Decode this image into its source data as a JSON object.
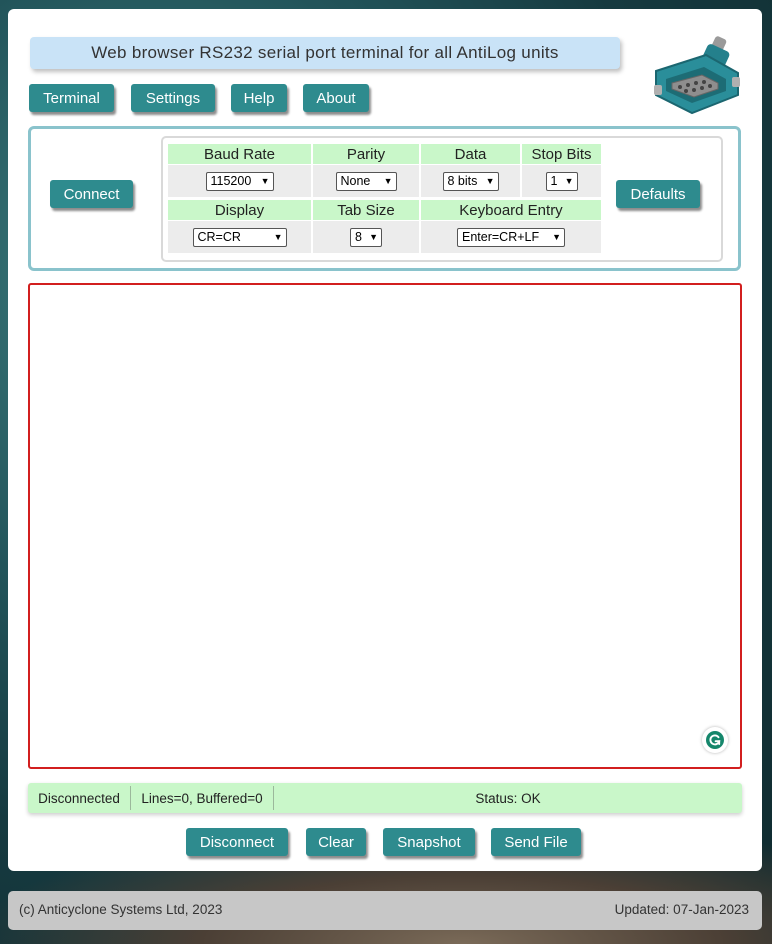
{
  "header": {
    "title": "Web browser RS232 serial port terminal for all AntiLog units",
    "logo_icon": "serial-connector-icon"
  },
  "nav": {
    "terminal": "Terminal",
    "settings": "Settings",
    "help": "Help",
    "about": "About"
  },
  "settings": {
    "connect_label": "Connect",
    "defaults_label": "Defaults",
    "baud_rate": {
      "label": "Baud Rate",
      "value": "115200"
    },
    "parity": {
      "label": "Parity",
      "value": "None"
    },
    "data_bits": {
      "label": "Data",
      "value": "8 bits"
    },
    "stop_bits": {
      "label": "Stop Bits",
      "value": "1"
    },
    "display": {
      "label": "Display",
      "value": "CR=CR"
    },
    "tab_size": {
      "label": "Tab Size",
      "value": "8"
    },
    "keyboard_entry": {
      "label": "Keyboard Entry",
      "value": "Enter=CR+LF"
    }
  },
  "terminal": {
    "content": "",
    "grammarly_icon": "grammarly-icon"
  },
  "status": {
    "connection": "Disconnected",
    "lines": "Lines=0, Buffered=0",
    "status": "Status: OK"
  },
  "actions": {
    "disconnect": "Disconnect",
    "clear": "Clear",
    "snapshot": "Snapshot",
    "send_file": "Send File"
  },
  "footer": {
    "copyright": "(c) Anticyclone Systems Ltd, 2023",
    "updated": "Updated: 07-Jan-2023"
  },
  "colors": {
    "button": "#2e8b8e",
    "header_cell": "#c9f7c9",
    "title_bg": "#c9e3f7",
    "terminal_border": "#d21f1f",
    "panel_border": "#8ac3cc"
  }
}
